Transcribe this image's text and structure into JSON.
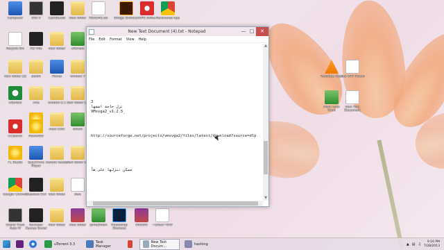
{
  "desktop": {
    "icons": [
      {
        "label": "Computer",
        "glyph": "computer-icon"
      },
      {
        "label": "GTA V",
        "glyph": "gta-icon"
      },
      {
        "label": "CamStudio",
        "glyph": "camera-icon"
      },
      {
        "label": "New folder",
        "glyph": "folder-icon"
      },
      {
        "label": "README.txt",
        "glyph": "file-icon"
      },
      {
        "label": "Bridge Shortcut",
        "glyph": "bridge-icon"
      },
      {
        "label": "WPS Office",
        "glyph": "office-icon"
      },
      {
        "label": "Recovered App",
        "glyph": "chrome-icon"
      },
      {
        "label": "Recycle Bin",
        "glyph": "recycle-icon"
      },
      {
        "label": "HD Vdo",
        "glyph": "dark-icon"
      },
      {
        "label": "New folder",
        "glyph": "folder-icon"
      },
      {
        "label": "uTorrent",
        "glyph": "app-icon"
      },
      {
        "label": "New folder (2)",
        "glyph": "folder-icon"
      },
      {
        "label": "aladin",
        "glyph": "folder-icon"
      },
      {
        "label": "iTunes",
        "glyph": "blue-icon"
      },
      {
        "label": "window 7",
        "glyph": "folder-icon"
      },
      {
        "label": "vms",
        "glyph": "folder-icon"
      },
      {
        "label": "uTorrent",
        "glyph": "utorrent-icon"
      },
      {
        "label": "Origin",
        "glyph": "origin-icon"
      },
      {
        "label": "window 8.1",
        "glyph": "folder-icon"
      },
      {
        "label": "New folder (3)",
        "glyph": "folder-icon"
      },
      {
        "label": "CCleaner",
        "glyph": "ccleaner-icon"
      },
      {
        "label": "PowerISO",
        "glyph": "disc-icon"
      },
      {
        "label": "Auto Click",
        "glyph": "folder-icon"
      },
      {
        "label": "dwtok",
        "glyph": "app-icon"
      },
      {
        "label": "FL Studio",
        "glyph": "flstudio-icon"
      },
      {
        "label": "QuickTime Player",
        "glyph": "quicktime-icon"
      },
      {
        "label": "roshaft reader",
        "glyph": "folder-icon"
      },
      {
        "label": "New folder (4)",
        "glyph": "folder-icon"
      },
      {
        "label": "Google Chrome",
        "glyph": "chrome-icon"
      },
      {
        "label": "Resident Evil",
        "glyph": "game-icon"
      },
      {
        "label": "New folder",
        "glyph": "folder-icon"
      },
      {
        "label": "New",
        "glyph": "file-icon"
      },
      {
        "label": "Grand Theft Auto IV",
        "glyph": "gta-icon"
      },
      {
        "label": "Rockstar Games Social",
        "glyph": "rockstar-icon"
      },
      {
        "label": "New folder",
        "glyph": "folder-icon"
      },
      {
        "label": "New folder",
        "glyph": "winrar-icon"
      },
      {
        "label": "IpmaSmart",
        "glyph": "app-icon"
      },
      {
        "label": "Photoshop Shortcut",
        "glyph": "photoshop-icon"
      },
      {
        "label": "WinRAR",
        "glyph": "winrar-icon"
      },
      {
        "label": "~$New~WW",
        "glyph": "file-icon"
      },
      {
        "label": "Vendetta Gym",
        "glyph": "vlc-icon"
      },
      {
        "label": "New WIP Frozen",
        "glyph": "checkbox-icon"
      },
      {
        "label": "Mera Auto Hook",
        "glyph": "app-icon"
      },
      {
        "label": "New Text Document",
        "glyph": "file-icon"
      }
    ]
  },
  "notepad": {
    "title": "New Text Document (4).txt - Notepad",
    "menu": [
      "File",
      "Edit",
      "Format",
      "View",
      "Help"
    ],
    "lines": [
      "",
      "",
      "",
      "",
      "",
      "",
      "",
      "",
      "",
      "",
      "",
      "3",
      "نزل حاجة اسمها",
      "VMsvga2_v1.2.5_",
      "",
      "",
      "",
      "",
      "http://sourceforge.net/projects/vmsvga2/files/latest/download?source=dlp",
      "",
      "",
      "",
      "",
      "",
      "",
      "ممكن تنزلها على هأ"
    ]
  },
  "taskbar": {
    "tasks": [
      {
        "label": "uTorrent 3.3",
        "icon": "utorrent-icon",
        "active": false
      },
      {
        "label": "Task Manager",
        "icon": "taskmanager-icon",
        "active": false
      },
      {
        "label": "",
        "icon": "chrome-icon",
        "active": false
      },
      {
        "label": "New Text Docum...",
        "icon": "notepad-icon",
        "active": true
      },
      {
        "label": "hashing",
        "icon": "window-icon",
        "active": false
      }
    ],
    "clock_time": "9:16 PM",
    "clock_date": "7/28/2013"
  }
}
